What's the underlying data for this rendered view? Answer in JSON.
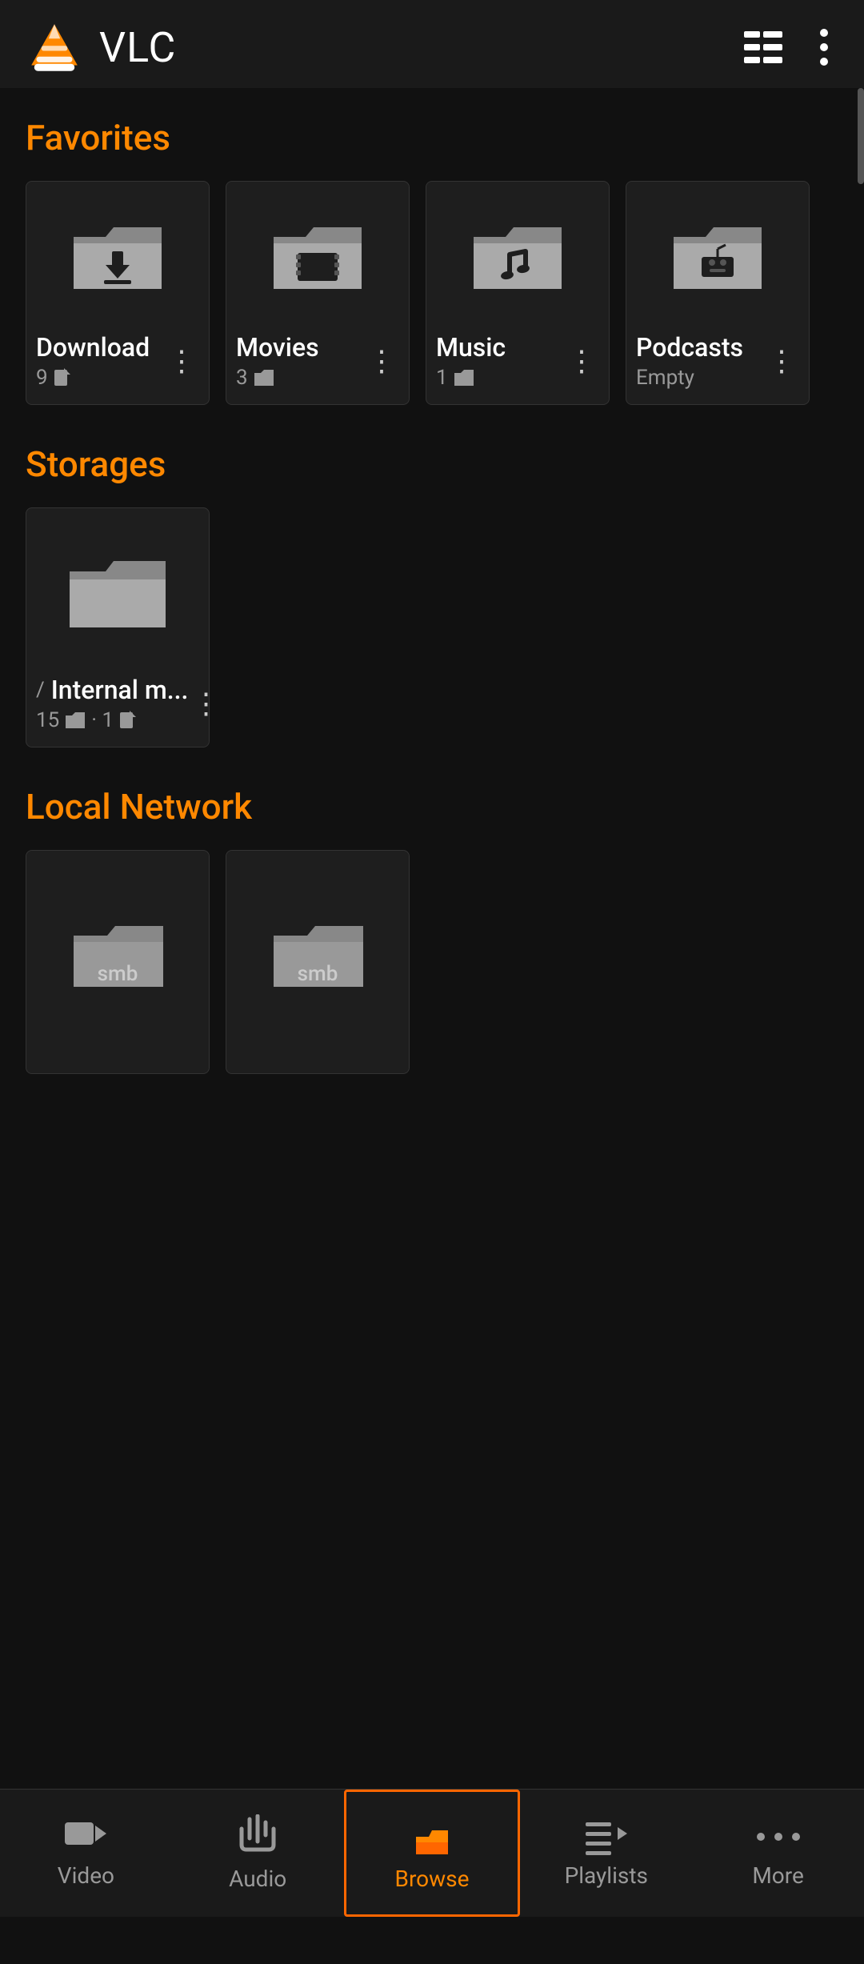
{
  "header": {
    "title": "VLC",
    "grid_icon": "grid-icon",
    "more_icon": "more-vertical-icon"
  },
  "sections": {
    "favorites": {
      "label": "Favorites",
      "cards": [
        {
          "name": "Download",
          "meta": "9",
          "meta_type": "file",
          "icon": "download-folder"
        },
        {
          "name": "Movies",
          "meta": "3",
          "meta_type": "folder",
          "icon": "movie-folder"
        },
        {
          "name": "Music",
          "meta": "1",
          "meta_type": "folder",
          "icon": "music-folder"
        },
        {
          "name": "Podcasts",
          "meta": "Empty",
          "meta_type": "empty",
          "icon": "podcast-folder"
        }
      ]
    },
    "storages": {
      "label": "Storages",
      "cards": [
        {
          "name": "Internal m...",
          "path": "/",
          "meta_folders": "15",
          "meta_files": "1",
          "icon": "storage-folder"
        }
      ]
    },
    "local_network": {
      "label": "Local Network",
      "cards": [
        {
          "name": "smb",
          "icon": "smb-folder"
        },
        {
          "name": "smb",
          "icon": "smb-folder"
        }
      ]
    }
  },
  "bottom_nav": {
    "items": [
      {
        "id": "video",
        "label": "Video",
        "icon": "video-icon",
        "active": false
      },
      {
        "id": "audio",
        "label": "Audio",
        "icon": "audio-icon",
        "active": false
      },
      {
        "id": "browse",
        "label": "Browse",
        "icon": "browse-icon",
        "active": true
      },
      {
        "id": "playlists",
        "label": "Playlists",
        "icon": "playlists-icon",
        "active": false
      },
      {
        "id": "more",
        "label": "More",
        "icon": "more-icon",
        "active": false
      }
    ]
  }
}
